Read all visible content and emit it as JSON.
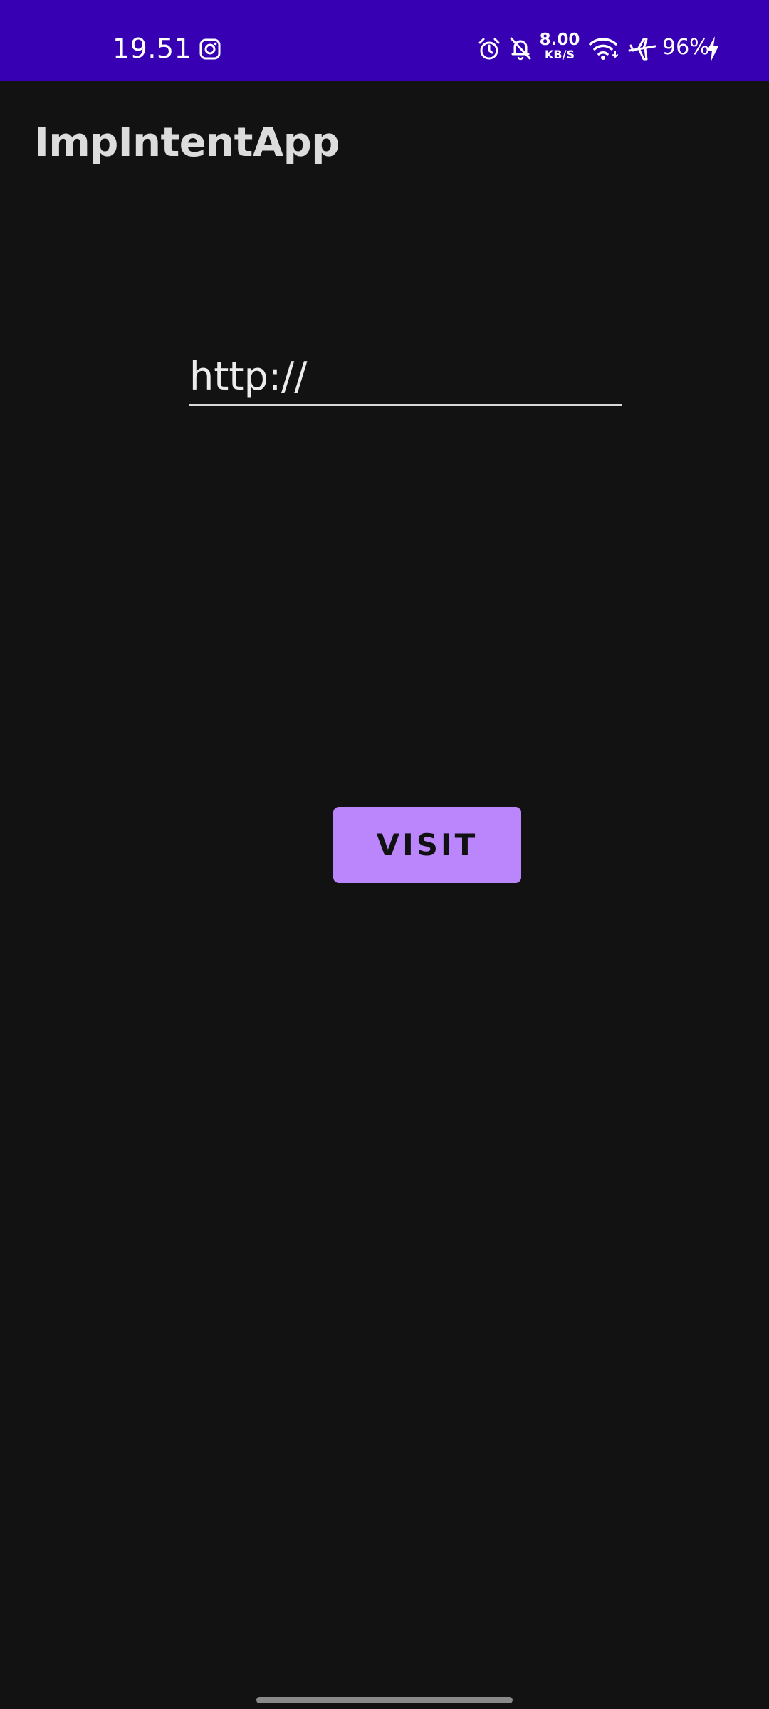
{
  "status_bar": {
    "time": "19.51",
    "net_speed_value": "8.00",
    "net_speed_unit": "KB/S",
    "battery": "96%",
    "background_color": "#3700b3",
    "icons": [
      "instagram-icon",
      "alarm-icon",
      "muted-bell-icon",
      "wifi-icon",
      "airplane-icon",
      "charging-bolt-icon"
    ]
  },
  "app_bar": {
    "title": "ImpIntentApp"
  },
  "main": {
    "url_input": {
      "value": "http://",
      "placeholder": ""
    },
    "visit_button": {
      "label": "VISIT",
      "color": "#bb86fc"
    }
  },
  "theme": {
    "background": "#121212"
  }
}
